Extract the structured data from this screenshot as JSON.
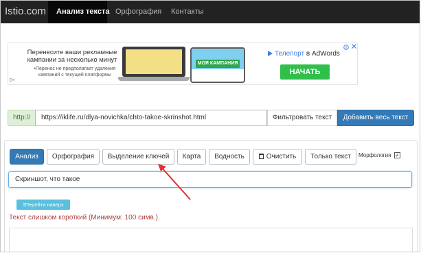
{
  "navbar": {
    "brand": "Istio.com",
    "items": [
      {
        "label": "Анализ текста",
        "active": true
      },
      {
        "label": "Орфография",
        "active": false
      },
      {
        "label": "Контакты",
        "active": false
      }
    ]
  },
  "ad": {
    "main_text": "Перенесите ваши рекламные кампании за несколько минут",
    "note": "•Перенос не предполагает удаления кампаний с текущей платформы",
    "mark": "0+",
    "phone_campaign": "МОЯ КАМПАНИЯ",
    "brand_prefix": "Телепорт",
    "brand_suffix": " в AdWords",
    "start_button": "НАЧАТЬ",
    "info_icon": "info-icon",
    "close_icon": "close-icon",
    "start_color": "#2fbf4a"
  },
  "url_row": {
    "prefix": "http://",
    "url_value": "https://iklife.ru/dlya-novichka/chto-takoe-skrinshot.html",
    "filter_button": "Фильтровать текст",
    "add_all_button": "Добавить весь текст",
    "accent": "#337ab7"
  },
  "tools": {
    "buttons": [
      {
        "label": "Анализ",
        "primary": true
      },
      {
        "label": "Орфография"
      },
      {
        "label": "Выделение ключей"
      },
      {
        "label": "Карта"
      },
      {
        "label": "Водность"
      },
      {
        "label": "Очистить",
        "icon": "trash-icon"
      },
      {
        "label": "Только текст"
      }
    ],
    "morphology_label": "Морфология",
    "morphology_checked": true,
    "text_value": "Скриншот, что такое",
    "top_button": "Перейти наверх",
    "warning": "Текст слишком короткий (Минимум: 100 симв.).",
    "warning_color": "#a94442"
  },
  "annotation": {
    "arrow_color": "#e03030"
  }
}
